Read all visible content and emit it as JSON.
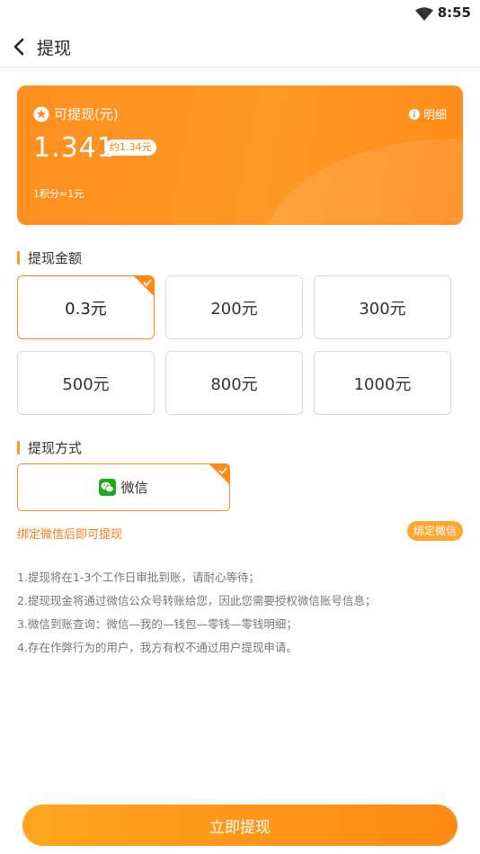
{
  "status_bar": {
    "time": "8:55",
    "wifi_icon": "wifi-icon"
  },
  "header": {
    "title": "提现",
    "back_icon": "chevron-left-icon"
  },
  "balance_card": {
    "label": "可提现(元)",
    "detail_label": "明细",
    "amount": "1.341",
    "approx": "约1.34元",
    "rate": "1积分=1元",
    "colors": {
      "start": "#ff8f1f",
      "end": "#ff8a1a"
    }
  },
  "amount_section": {
    "title": "提现金额",
    "options": [
      "0.3元",
      "200元",
      "300元",
      "500元",
      "800元",
      "1000元"
    ],
    "selected_index": 0
  },
  "method_section": {
    "title": "提现方式",
    "option_label": "微信",
    "selected": true
  },
  "bind": {
    "hint": "绑定微信后即可提现",
    "button": "绑定微信"
  },
  "notes": [
    "1.提现将在1-3个工作日审批到账，请耐心等待；",
    "2.提现现金将通过微信公众号转账给您，因此您需要授权微信账号信息；",
    "3.微信到账查询：微信—我的—钱包—零钱—零钱明细；",
    "4.存在作弊行为的用户，我方有权不通过用户提现申请。"
  ],
  "submit_label": "立即提现",
  "accent_color": "#ff8a1a"
}
